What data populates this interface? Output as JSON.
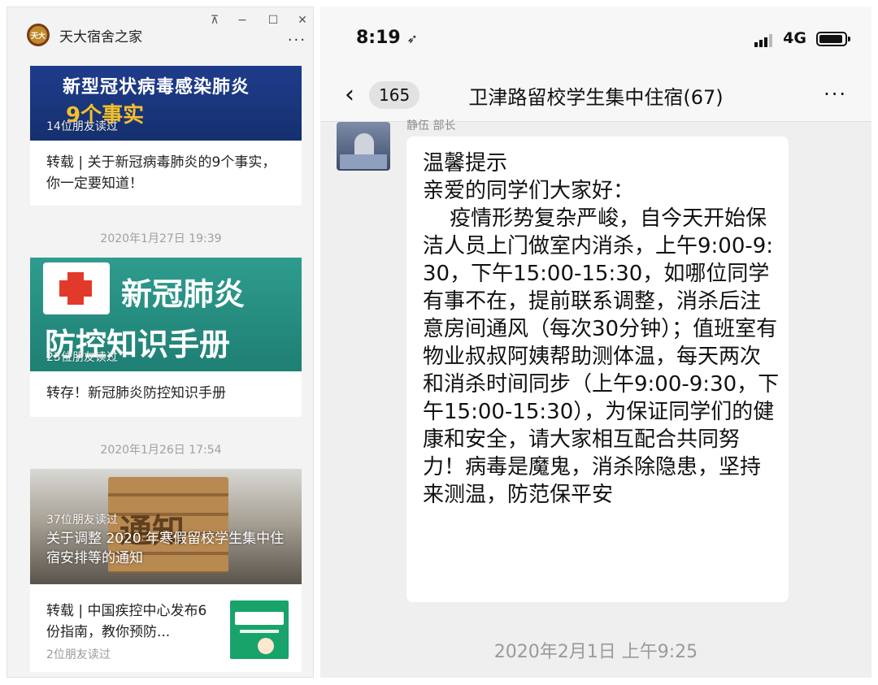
{
  "left_window": {
    "app_title": "天大宿舍之家",
    "controls": {
      "pin": "⊼",
      "minimize": "−",
      "maximize": "☐",
      "close": "✕",
      "more": "···"
    },
    "logo_text": "天大",
    "articles": [
      {
        "thumb_title": "新型冠状病毒感染肺炎",
        "thumb_sub": "9个事实",
        "readers": "14位朋友读过",
        "title": "转载 | 关于新冠病毒肺炎的9个事实，你一定要知道！"
      },
      {
        "date": "2020年1月27日 19:39",
        "thumb_line1": "新冠肺炎",
        "thumb_line2": "防控知识手册",
        "readers": "23位朋友读过",
        "title": "转存！新冠肺炎防控知识手册"
      },
      {
        "date": "2020年1月26日 17:54",
        "thumb_word": "通知",
        "readers": "37位朋友读过",
        "overlay_title": "关于调整 2020 年寒假留校学生集中住宿安排等的通知",
        "sub_title": "转载 | 中国疾控中心发布6份指南，教你预防...",
        "sub_readers": "2位朋友读过"
      }
    ]
  },
  "right_phone": {
    "status": {
      "time": "8:19",
      "location_icon": "➶",
      "network": "4G"
    },
    "nav": {
      "back_icon": "‹",
      "unread_count": "165",
      "title": "卫津路留校学生集中住宿(67)",
      "more": "···"
    },
    "message": {
      "sender": "静伍 部长",
      "text": "温馨提示\n亲爱的同学们大家好：\n    疫情形势复杂严峻，自今天开始保洁人员上门做室内消杀，上午9:00-9:30，下午15:00-15:30，如哪位同学有事不在，提前联系调整，消杀后注意房间通风（每次30分钟）；值班室有物业叔叔阿姨帮助测体温，每天两次和消杀时间同步（上午9:00-9:30，下午15:00-15:30），为保证同学们的健康和安全，请大家相互配合共同努力！病毒是魔鬼，消杀除隐患，坚持来测温，防范保平安",
      "timestamp": "2020年2月1日 上午9:25"
    }
  }
}
